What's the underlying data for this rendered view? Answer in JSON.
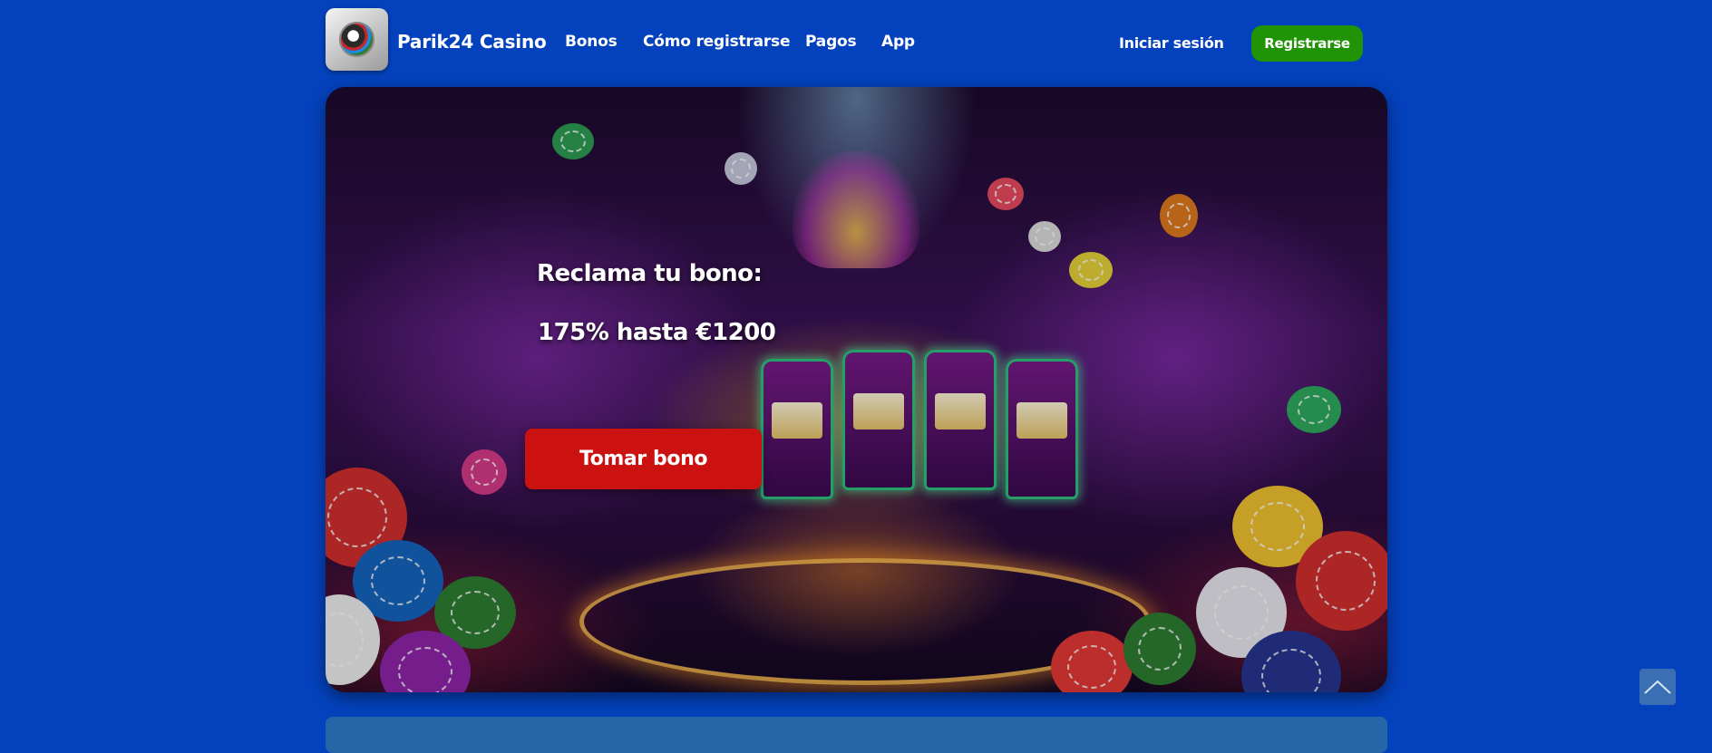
{
  "header": {
    "brand_name": "Parik24 Casino",
    "logo_icon": "casino-chip-logo",
    "nav": [
      "Bonos",
      "Cómo registrarse",
      "Pagos",
      "App"
    ],
    "login_label": "Iniciar sesión",
    "register_label": "Registrarse"
  },
  "hero": {
    "title": "Reclama tu bono:",
    "offer": "175% hasta €1200",
    "cta_label": "Tomar bono",
    "background": "casino slot machines illustration"
  },
  "scroll_top_icon": "chevron-up-icon",
  "colors": {
    "page_background": "#0442bd",
    "register_button": "#219306",
    "cta_button": "#cc1111",
    "bottom_panel": "#2566a8"
  }
}
